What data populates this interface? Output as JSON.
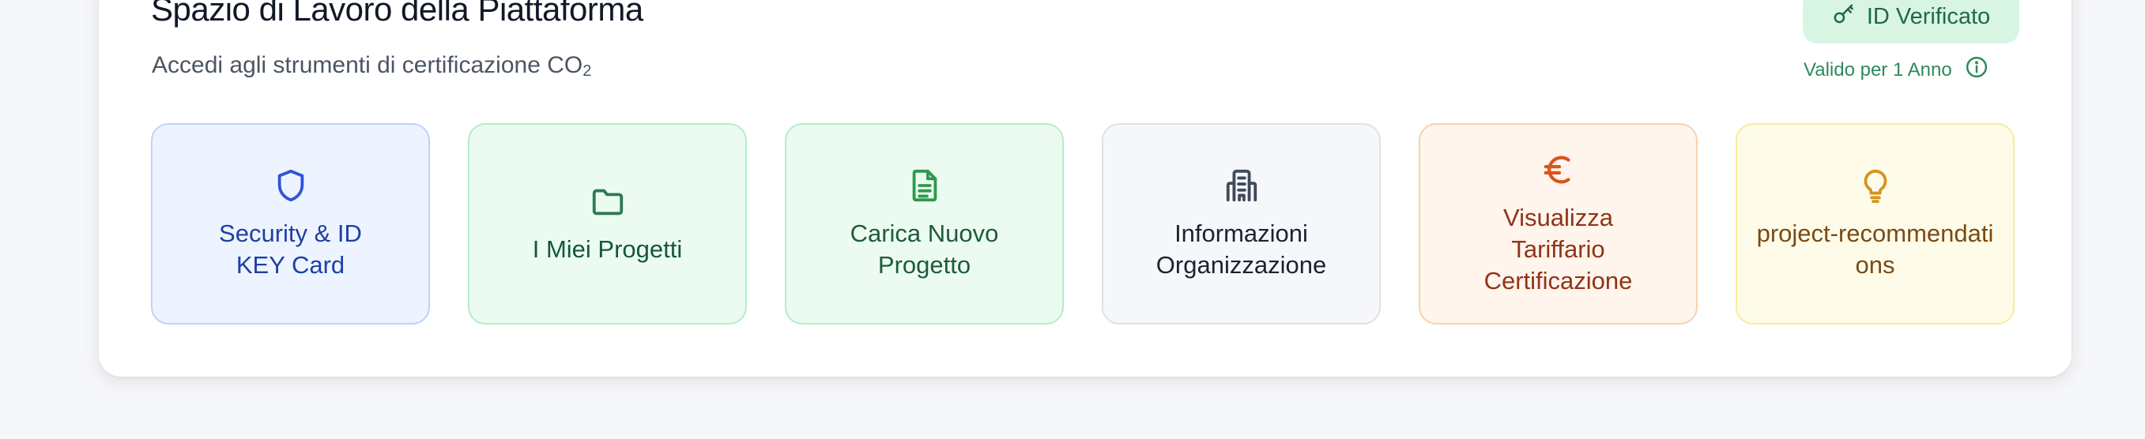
{
  "header": {
    "title": "Spazio di Lavoro della Piattaforma",
    "subtitle": "Accedi agli strumenti di certificazione CO",
    "subtitle_subscript": "2"
  },
  "badge": {
    "label": "ID Verificato",
    "icon": "key-icon"
  },
  "validity": {
    "label": "Valido per 1 Anno",
    "icon": "info-icon"
  },
  "colors": {
    "security": "#1e3fa6",
    "projects": "#2f7a52",
    "upload": "#2e9a4c",
    "organization": "#414a5a",
    "pricing": "#d9541e",
    "recommendations": "#d4951e"
  },
  "cards": [
    {
      "label": "Security & ID KEY Card",
      "icon": "shield-icon"
    },
    {
      "label": "I Miei Progetti",
      "icon": "folder-icon"
    },
    {
      "label": "Carica Nuovo Progetto",
      "icon": "document-icon"
    },
    {
      "label": "Informazioni Organizzazione",
      "icon": "building-icon"
    },
    {
      "label": "Visualizza Tariffario Certificazione",
      "icon": "euro-icon"
    },
    {
      "label": "project-recommendations",
      "icon": "lightbulb-icon"
    }
  ]
}
